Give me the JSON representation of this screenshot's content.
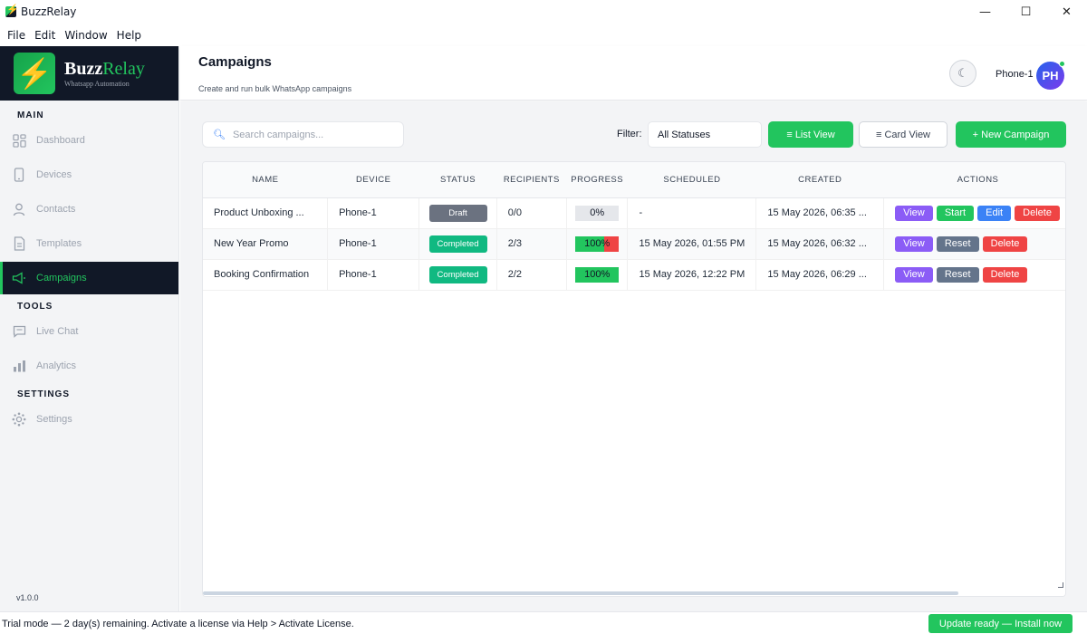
{
  "window": {
    "title": "BuzzRelay",
    "controls": {
      "minimize": "—",
      "maximize": "☐",
      "close": "✕"
    }
  },
  "menu": [
    "File",
    "Edit",
    "Window",
    "Help"
  ],
  "brand": {
    "name_part1": "Buzz",
    "name_part2": "Relay",
    "subtitle": "Whatsapp Automation",
    "logo_icon": "lightning-bolt"
  },
  "sidebar": {
    "sections": {
      "main": "MAIN",
      "tools": "TOOLS",
      "settings": "SETTINGS"
    },
    "items": [
      {
        "label": "Dashboard",
        "icon": "dashboard-icon"
      },
      {
        "label": "Devices",
        "icon": "phone-icon"
      },
      {
        "label": "Contacts",
        "icon": "person-icon"
      },
      {
        "label": "Templates",
        "icon": "document-icon"
      },
      {
        "label": "Campaigns",
        "icon": "megaphone-icon",
        "active": true
      },
      {
        "label": "Live Chat",
        "icon": "chat-icon"
      },
      {
        "label": "Analytics",
        "icon": "bar-chart-icon"
      },
      {
        "label": "Settings",
        "icon": "gear-icon"
      }
    ],
    "version": "v1.0.0"
  },
  "header": {
    "title": "Campaigns",
    "subtitle": "Create and run bulk WhatsApp campaigns",
    "theme_icon": "☾",
    "device": "Phone-1",
    "avatar": "PH"
  },
  "toolbar": {
    "search_placeholder": "Search campaigns...",
    "filter_label": "Filter:",
    "filter_value": "All Statuses",
    "list_view": "≡  List View",
    "card_view": "≡  Card View",
    "new_campaign": "+ New Campaign"
  },
  "table": {
    "columns": [
      "NAME",
      "DEVICE",
      "STATUS",
      "RECIPIENTS",
      "PROGRESS",
      "SCHEDULED",
      "CREATED",
      "ACTIONS"
    ],
    "rows": [
      {
        "name": "Product Unboxing ...",
        "device": "Phone-1",
        "status": "Draft",
        "recipients": "0/0",
        "progress": "0%",
        "progress_success": 0,
        "progress_failed": 0,
        "scheduled": "-",
        "created": "15 May 2026, 06:35 ...",
        "actions": [
          "View",
          "Start",
          "Edit",
          "Delete"
        ]
      },
      {
        "name": "New Year Promo",
        "device": "Phone-1",
        "status": "Completed",
        "recipients": "2/3",
        "progress": "100%",
        "progress_success": 0.67,
        "progress_failed": 0.33,
        "scheduled": "15 May 2026, 01:55 PM",
        "created": "15 May 2026, 06:32 ...",
        "actions": [
          "View",
          "Reset",
          "Delete"
        ]
      },
      {
        "name": "Booking Confirmation",
        "device": "Phone-1",
        "status": "Completed",
        "recipients": "2/2",
        "progress": "100%",
        "progress_success": 1,
        "progress_failed": 0,
        "scheduled": "15 May 2026, 12:22 PM",
        "created": "15 May 2026, 06:29 ...",
        "actions": [
          "View",
          "Reset",
          "Delete"
        ]
      }
    ]
  },
  "statusbar": {
    "trial": "Trial mode — 2 day(s) remaining. Activate a license via Help > Activate License.",
    "update": "Update ready — Install now"
  },
  "colors": {
    "accent": "#22c55e",
    "sidebar_dark": "#111827",
    "danger": "#ef4444",
    "view": "#8b5cf6",
    "edit": "#3b82f6"
  }
}
